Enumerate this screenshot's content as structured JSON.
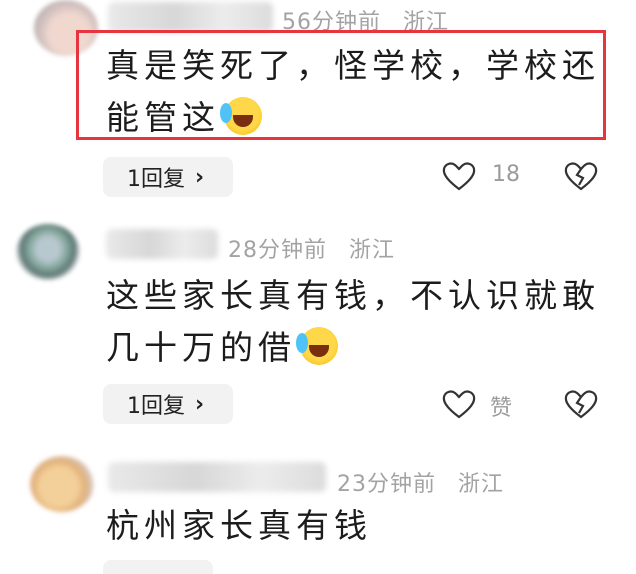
{
  "comments": [
    {
      "time": "56分钟前",
      "location": "浙江",
      "text_line1": "真是笑死了，怪学校，学校还",
      "text_line2": "能管这",
      "emoji": "face-with-tears-of-joy",
      "reply_label": "1回复",
      "likes": "18",
      "highlighted": true
    },
    {
      "time": "28分钟前",
      "location": "浙江",
      "text_line1": "这些家长真有钱，不认识就敢",
      "text_line2": "几十万的借",
      "emoji": "face-with-tears-of-joy",
      "reply_label": "1回复",
      "likes": "赞",
      "highlighted": false
    },
    {
      "time": "23分钟前",
      "location": "浙江",
      "text_line1": "杭州家长真有钱",
      "highlighted": false
    }
  ],
  "colors": {
    "highlight_border": "#e8343e",
    "meta_text": "#a3a3a3",
    "reply_bg": "#f2f2f2"
  },
  "icons": [
    "heart-outline-icon",
    "broken-heart-icon",
    "chevron-right-icon"
  ]
}
